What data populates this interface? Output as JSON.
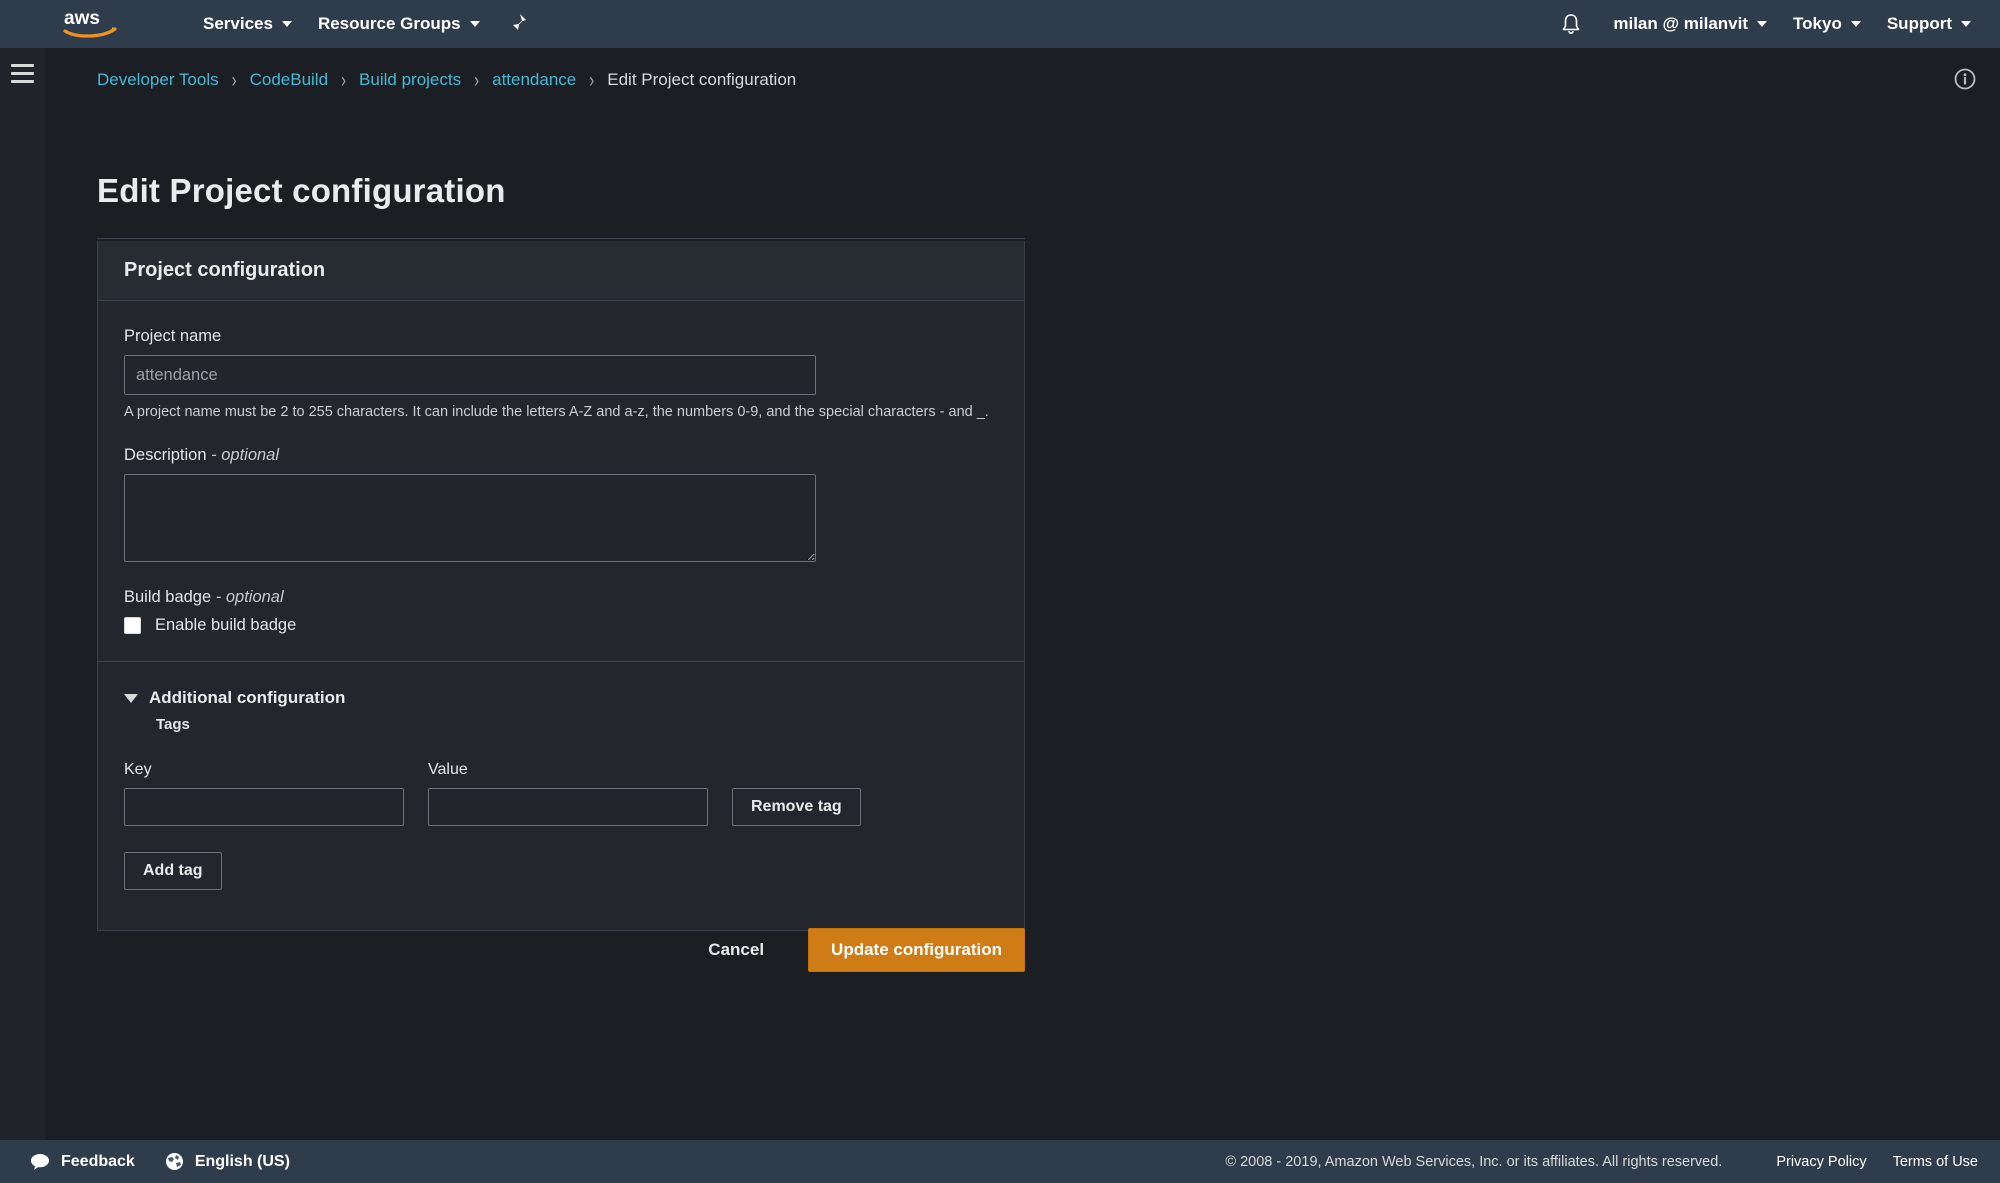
{
  "topnav": {
    "logo_alt": "aws",
    "items": [
      {
        "label": "Services",
        "has_caret": true
      },
      {
        "label": "Resource Groups",
        "has_caret": true
      }
    ],
    "pin_icon": "pin-icon",
    "bell_icon": "bell-icon",
    "account": {
      "label": "milan @ milanvit",
      "has_caret": true
    },
    "region": {
      "label": "Tokyo",
      "has_caret": true
    },
    "support": {
      "label": "Support",
      "has_caret": true
    }
  },
  "sidebar": {
    "menu_icon": "hamburger-menu-icon"
  },
  "content": {
    "info_icon": "info-circle-icon",
    "breadcrumb": [
      {
        "label": "Developer Tools",
        "link": true
      },
      {
        "label": "CodeBuild",
        "link": true
      },
      {
        "label": "Build projects",
        "link": true
      },
      {
        "label": "attendance",
        "link": true
      },
      {
        "label": "Edit Project configuration",
        "link": false
      }
    ],
    "breadcrumb_separator": "›",
    "page_title": "Edit Project configuration"
  },
  "card": {
    "header_title": "Project configuration",
    "project_name": {
      "label": "Project name",
      "value": "attendance",
      "placeholder": "",
      "helper": "A project name must be 2 to 255 characters. It can include the letters A-Z and a-z, the numbers 0-9, and the special characters - and _."
    },
    "description": {
      "label": "Description",
      "optional_suffix": "- optional",
      "value": "",
      "placeholder": ""
    },
    "build_badge": {
      "label": "Build badge",
      "optional_suffix": "- optional",
      "checkbox_label": "Enable build badge",
      "checked": false
    },
    "additional_configuration": {
      "title": "Additional configuration",
      "expanded": true,
      "tags_subtitle": "Tags",
      "key_column_label": "Key",
      "value_column_label": "Value",
      "rows": [
        {
          "key": "",
          "value": "",
          "remove_label": "Remove tag"
        }
      ],
      "add_tag_label": "Add tag"
    }
  },
  "actions": {
    "cancel_label": "Cancel",
    "update_label": "Update configuration",
    "primary_color": "#d07c16"
  },
  "footer": {
    "feedback_label": "Feedback",
    "feedback_icon": "speech-bubble-icon",
    "language_label": "English (US)",
    "language_icon": "globe-icon",
    "copyright": "© 2008 - 2019, Amazon Web Services, Inc. or its affiliates. All rights reserved.",
    "privacy_label": "Privacy Policy",
    "terms_label": "Terms of Use"
  }
}
